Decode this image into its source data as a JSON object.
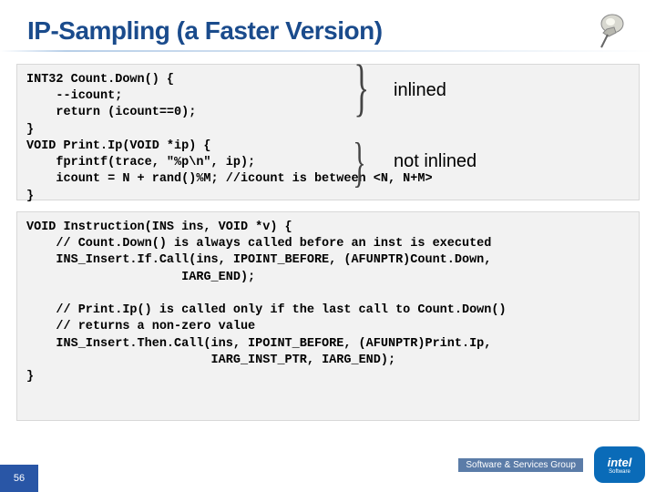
{
  "title": "IP-Sampling (a Faster Version)",
  "code1": "INT32 Count.Down() {\n    --icount;\n    return (icount==0);\n}\nVOID Print.Ip(VOID *ip) {\n    fprintf(trace, \"%p\\n\", ip);\n    icount = N + rand()%M; //icount is between <N, N+M>\n}",
  "annot_inlined": "inlined",
  "annot_notinlined": "not inlined",
  "code2": "VOID Instruction(INS ins, VOID *v) {\n    // Count.Down() is always called before an inst is executed\n    INS_Insert.If.Call(ins, IPOINT_BEFORE, (AFUNPTR)Count.Down,\n                     IARG_END);\n\n    // Print.Ip() is called only if the last call to Count.Down()\n    // returns a non-zero value\n    INS_Insert.Then.Call(ins, IPOINT_BEFORE, (AFUNPTR)Print.Ip,\n                         IARG_INST_PTR, IARG_END);\n}",
  "footer": "Software & Services Group",
  "logo_word": "intel",
  "logo_sub": "Software",
  "pagenum": "56"
}
